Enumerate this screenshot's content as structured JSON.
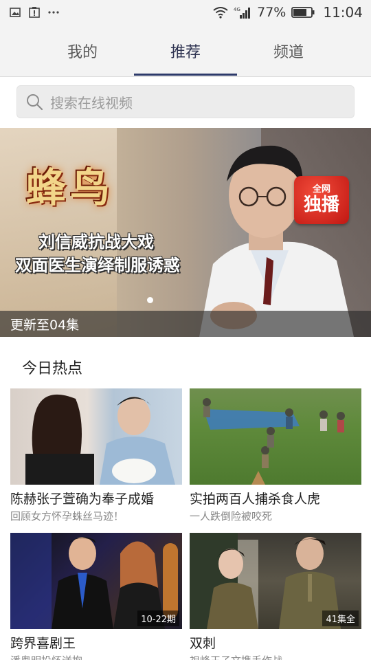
{
  "status_bar": {
    "battery_pct": "77%",
    "time": "11:04",
    "network_type": "4G",
    "icons": [
      "image-notification-icon",
      "alert-notification-icon",
      "more-dots-icon",
      "wifi-icon",
      "signal-icon",
      "battery-icon"
    ]
  },
  "tabs": [
    {
      "label": "我的"
    },
    {
      "label": "推荐"
    },
    {
      "label": "频道"
    }
  ],
  "active_tab": "推荐",
  "search": {
    "placeholder": "搜索在线视频"
  },
  "banner": {
    "logo_text": "蜂鸟",
    "line1": "刘信威抗战大戏",
    "line2": "双面医生演绎制服诱惑",
    "badge_top": "全网",
    "badge_main": "独播",
    "caption": "更新至04集"
  },
  "section": {
    "title": "今日热点"
  },
  "cards": [
    {
      "title": "陈赫张子萱确为奉子成婚",
      "subtitle": "回顾女方怀孕蛛丝马迹！",
      "tag": ""
    },
    {
      "title": "实拍两百人捕杀食人虎",
      "subtitle": "一人跌倒险被咬死",
      "tag": ""
    },
    {
      "title": "跨界喜剧王",
      "subtitle": "潘粤明投怀送抱",
      "tag": "10-22期"
    },
    {
      "title": "双刺",
      "subtitle": "祖峰王子文携手作战",
      "tag": "41集全"
    }
  ],
  "colors": {
    "accent": "#2d3a6a",
    "tabbar_bg": "#f3f3f3",
    "badge_red": "#d42118"
  }
}
